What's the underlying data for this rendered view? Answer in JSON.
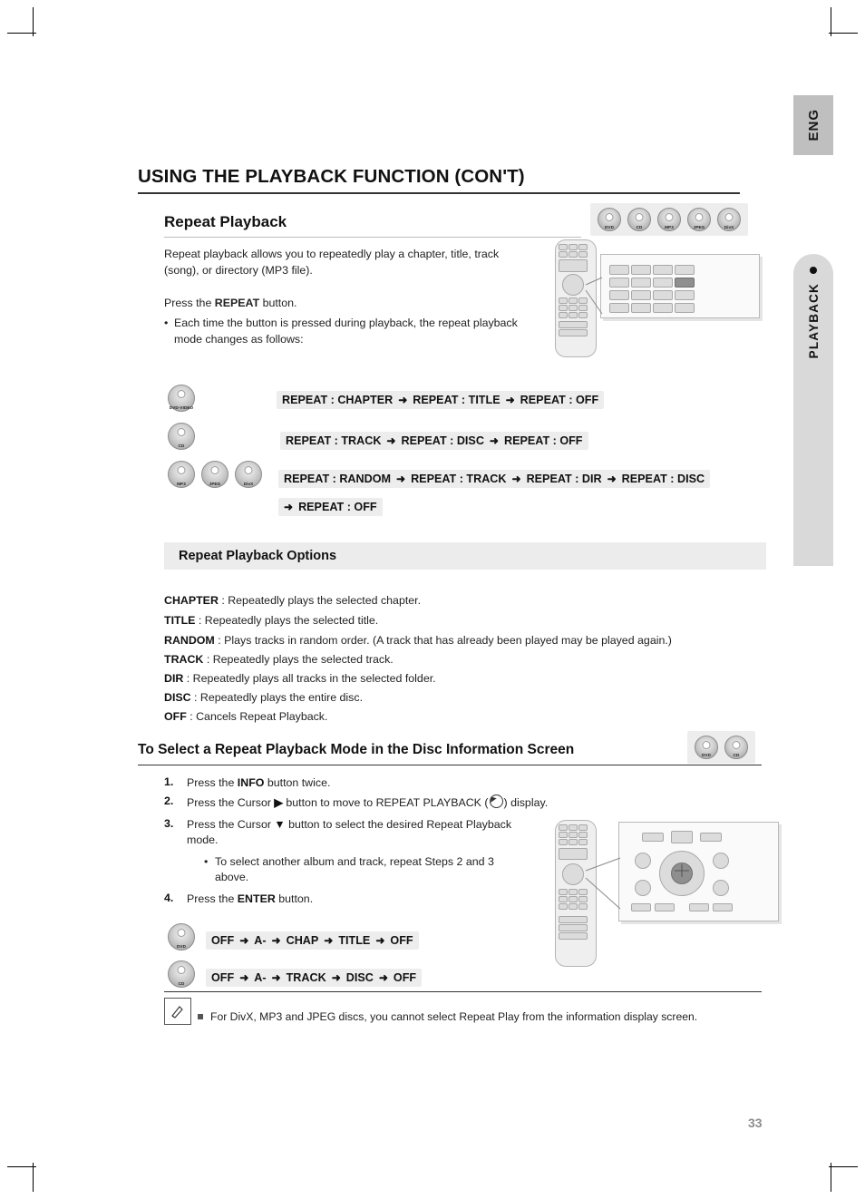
{
  "page": {
    "language_tab": "ENG",
    "side_tab": "PLAYBACK",
    "number": "33"
  },
  "heading": "USING THE PLAYBACK FUNCTION (CON'T)",
  "section1": {
    "title": "Repeat Playback",
    "badges": [
      "DVD",
      "CD",
      "MP3",
      "JPEG",
      "DivX"
    ],
    "intro": "Repeat playback allows you to repeatedly play a chapter, title, track (song), or directory (MP3 file).",
    "press_line_prefix": "Press the ",
    "press_line_bold": "REPEAT",
    "press_line_suffix": " button.",
    "bullet": "Each time the button is pressed during playback, the repeat playback mode  changes as follows:",
    "flows": [
      {
        "badges": [
          "DVD-VIDEO"
        ],
        "items": [
          "REPEAT : CHAPTER",
          "REPEAT : TITLE",
          "REPEAT : OFF"
        ]
      },
      {
        "badges": [
          "CD"
        ],
        "items": [
          "REPEAT : TRACK",
          "REPEAT : DISC",
          "REPEAT : OFF"
        ]
      },
      {
        "badges": [
          "MP3",
          "JPEG",
          "DivX"
        ],
        "items": [
          "REPEAT : RANDOM",
          "REPEAT : TRACK",
          "REPEAT : DIR",
          "REPEAT : DISC"
        ]
      }
    ],
    "flow3_wrap": "REPEAT : OFF"
  },
  "options": {
    "bar_title": "Repeat Playback Options",
    "items": [
      {
        "term": "CHAPTER",
        "desc": " : Repeatedly plays the selected chapter."
      },
      {
        "term": "TITLE",
        "desc": " : Repeatedly plays the selected title."
      },
      {
        "term": "RANDOM",
        "desc": " : Plays tracks in random order. (A track that has already been played may be played again.)"
      },
      {
        "term": "TRACK",
        "desc": " : Repeatedly plays the selected track."
      },
      {
        "term": "DIR",
        "desc": " : Repeatedly plays all tracks in the selected folder."
      },
      {
        "term": "DISC",
        "desc": " : Repeatedly plays the entire disc."
      },
      {
        "term": "OFF",
        "desc": " : Cancels Repeat Playback."
      }
    ]
  },
  "section2": {
    "title": "To Select a Repeat Playback Mode in the Disc Information Screen",
    "badges": [
      "DVD",
      "CD"
    ],
    "steps": [
      {
        "num": "1.",
        "pre": "Press the ",
        "bold": "INFO",
        "post": " button twice."
      },
      {
        "num": "2.",
        "pre": "Press the Cursor ",
        "bold": "▶",
        "post": " button to move to REPEAT PLAYBACK (",
        "post2": ") display."
      },
      {
        "num": "3.",
        "pre": "Press the Cursor ",
        "bold": "▼",
        "post": " button to select the desired Repeat Playback mode.",
        "sub": "To select another album and track, repeat Steps 2 and 3 above."
      },
      {
        "num": "4.",
        "pre": "Press the ",
        "bold": "ENTER",
        "post": " button."
      }
    ],
    "flows": [
      {
        "badges": [
          "DVD"
        ],
        "items": [
          "OFF",
          "A-",
          "CHAP",
          "TITLE",
          "OFF"
        ]
      },
      {
        "badges": [
          "CD"
        ],
        "items": [
          "OFF",
          "A-",
          "TRACK",
          "DISC",
          "OFF"
        ]
      }
    ]
  },
  "note": {
    "text": "For DivX, MP3 and JPEG discs, you cannot select Repeat Play from the information display screen."
  },
  "colors": {
    "accent_grey": "#ededed",
    "bar_grey": "#ececec",
    "tab_grey": "#bfbfbf",
    "side_grey": "#d9d9d9",
    "page_number": "#8c8c8c"
  }
}
